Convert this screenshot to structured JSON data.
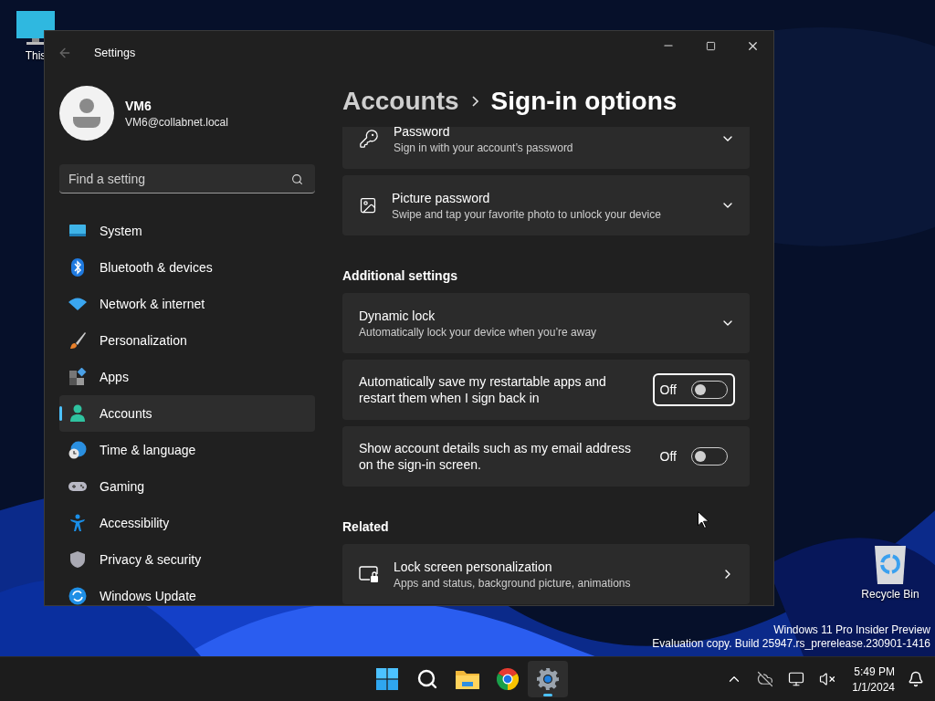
{
  "desktop": {
    "icons": [
      {
        "kind": "pc",
        "label": "This"
      },
      {
        "kind": "recycle",
        "label": "Recycle Bin"
      }
    ],
    "watermark": [
      "Windows 11 Pro Insider Preview",
      "Evaluation copy. Build 25947.rs_prerelease.230901-1416"
    ]
  },
  "window": {
    "title": "Settings"
  },
  "account": {
    "name": "VM6",
    "email": "VM6@collabnet.local"
  },
  "search": {
    "placeholder": "Find a setting"
  },
  "sidebar": {
    "items": [
      {
        "label": "System",
        "selected": false
      },
      {
        "label": "Bluetooth & devices",
        "selected": false
      },
      {
        "label": "Network & internet",
        "selected": false
      },
      {
        "label": "Personalization",
        "selected": false
      },
      {
        "label": "Apps",
        "selected": false
      },
      {
        "label": "Accounts",
        "selected": true
      },
      {
        "label": "Time & language",
        "selected": false
      },
      {
        "label": "Gaming",
        "selected": false
      },
      {
        "label": "Accessibility",
        "selected": false
      },
      {
        "label": "Privacy & security",
        "selected": false
      },
      {
        "label": "Windows Update",
        "selected": false
      }
    ]
  },
  "breadcrumb": [
    "Accounts",
    "Sign-in options"
  ],
  "sections": [
    {
      "items": [
        {
          "kind": "expander",
          "title": "Password",
          "subtitle": "Sign in with your account’s password"
        },
        {
          "kind": "expander",
          "title": "Picture password",
          "subtitle": "Swipe and tap your favorite photo to unlock your device"
        }
      ]
    },
    {
      "heading": "Additional settings",
      "items": [
        {
          "kind": "expander",
          "title": "Dynamic lock",
          "subtitle": "Automatically lock your device when you’re away"
        },
        {
          "kind": "toggle",
          "title": "Automatically save my restartable apps and restart them when I sign back in",
          "state": "Off",
          "on": false,
          "focused": true
        },
        {
          "kind": "toggle",
          "title": "Show account details such as my email address on the sign-in screen.",
          "state": "Off",
          "on": false,
          "focused": false
        }
      ]
    },
    {
      "heading": "Related",
      "items": [
        {
          "kind": "link",
          "title": "Lock screen personalization",
          "subtitle": "Apps and status, background picture, animations"
        }
      ]
    }
  ],
  "taskbar": {
    "apps": [
      {
        "kind": "start",
        "active": false
      },
      {
        "kind": "search",
        "active": false
      },
      {
        "kind": "explorer",
        "active": false
      },
      {
        "kind": "chrome",
        "active": false
      },
      {
        "kind": "settings",
        "active": true
      }
    ],
    "clock": {
      "time": "5:49 PM",
      "date": "1/1/2024"
    }
  }
}
